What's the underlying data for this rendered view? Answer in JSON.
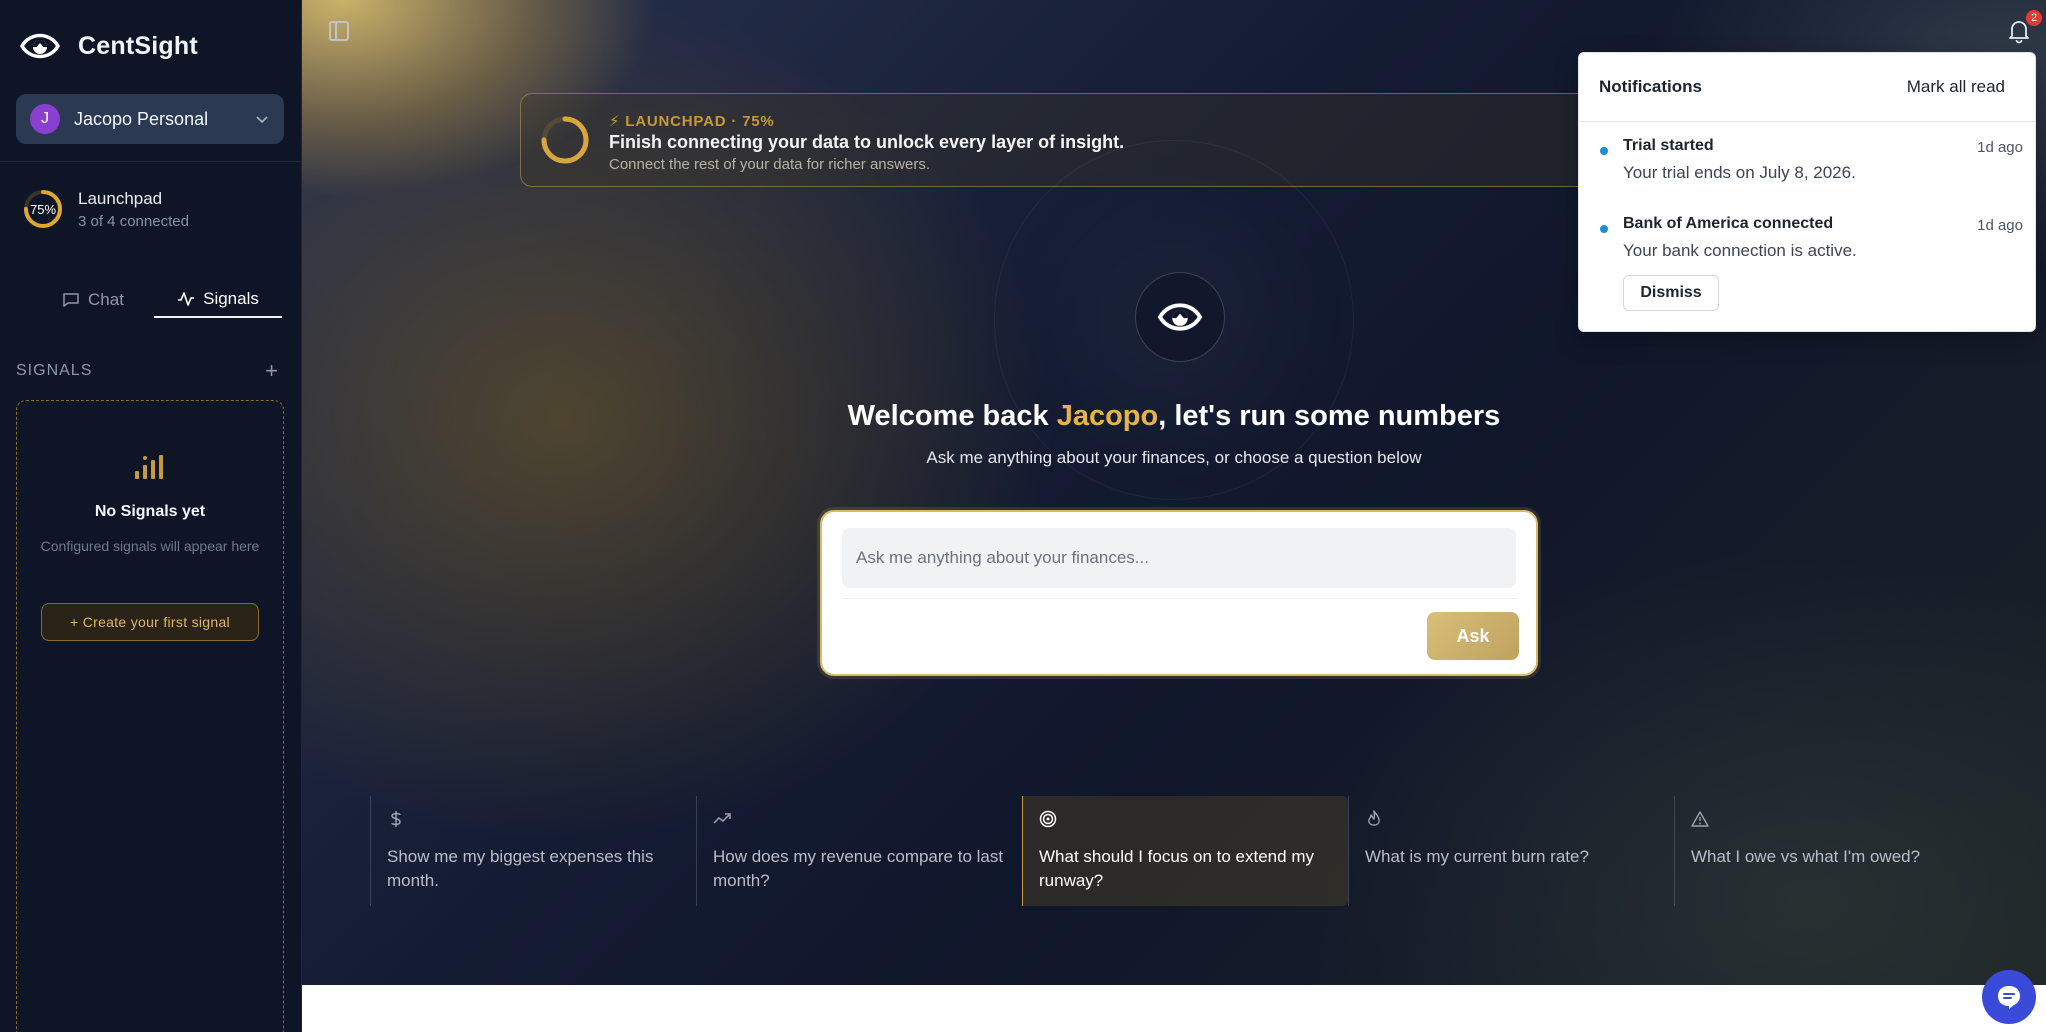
{
  "sidebar": {
    "brand": "CentSight",
    "workspace": {
      "initial": "J",
      "name": "Jacopo Personal"
    },
    "launchpad": {
      "percent": "75%",
      "title": "Launchpad",
      "subtitle": "3 of 4 connected",
      "progress": 0.75
    },
    "tabs": [
      {
        "label": "Chat"
      },
      {
        "label": "Signals"
      }
    ],
    "active_tab": "Signals",
    "signals": {
      "heading": "SIGNALS",
      "add": "+",
      "empty_title": "No Signals yet",
      "empty_subtitle": "Configured signals will appear here",
      "create_label": "+ Create your first signal"
    }
  },
  "notifications": {
    "badge_count": "2",
    "title": "Notifications",
    "mark_all": "Mark all read",
    "items": [
      {
        "title": "Trial started",
        "time": "1d ago",
        "body": "Your trial ends on July 8, 2026."
      },
      {
        "title": "Bank of America connected",
        "time": "1d ago",
        "body": "Your bank connection is active.",
        "action": "Dismiss"
      }
    ]
  },
  "banner": {
    "kicker": "⚡ LAUNCHPAD · 75%",
    "title": "Finish connecting your data to unlock every layer of insight.",
    "subtitle": "Connect the rest of your data for richer answers.",
    "progress": 0.75
  },
  "hero": {
    "welcome_prefix": "Welcome back ",
    "welcome_name": "Jacopo",
    "welcome_suffix": ", let's run some numbers",
    "subtitle": "Ask me anything about your finances, or choose a question below"
  },
  "ask": {
    "placeholder": "Ask me anything about your finances...",
    "button": "Ask"
  },
  "suggestions": [
    {
      "icon": "dollar-icon",
      "text": "Show me my biggest expenses this month."
    },
    {
      "icon": "trending-up-icon",
      "text": "How does my revenue compare to last month?"
    },
    {
      "icon": "target-icon",
      "text": "What should I focus on to extend my runway?"
    },
    {
      "icon": "flame-icon",
      "text": "What is my current burn rate?"
    },
    {
      "icon": "warning-icon",
      "text": "What I owe vs what I'm owed?"
    }
  ],
  "colors": {
    "accent_gold": "#e6b34a",
    "sidebar_bg": "#0d1526",
    "chat_fab": "#3b4bd9",
    "notif_dot": "#1a8fd6"
  }
}
